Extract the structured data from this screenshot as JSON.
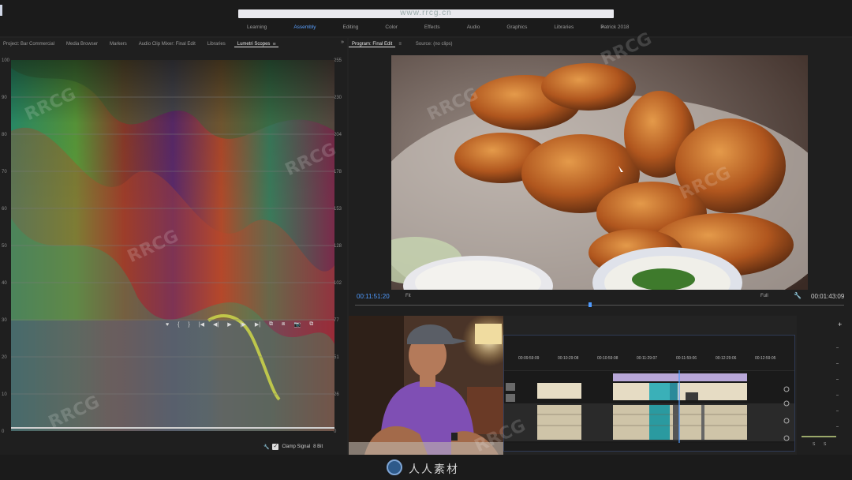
{
  "titlebar": {
    "url_text": "www.rrcg.cn"
  },
  "workspaces": {
    "tabs": [
      {
        "label": "Learning",
        "active": false
      },
      {
        "label": "Assembly",
        "active": true
      },
      {
        "label": "Editing",
        "active": false
      },
      {
        "label": "Color",
        "active": false
      },
      {
        "label": "Effects",
        "active": false
      },
      {
        "label": "Audio",
        "active": false
      },
      {
        "label": "Graphics",
        "active": false
      },
      {
        "label": "Libraries",
        "active": false
      },
      {
        "label": "Patrick 2018",
        "active": false
      }
    ],
    "more": "»"
  },
  "left_panel": {
    "tabs": [
      {
        "label": "Project: Bar Commercial",
        "active": false
      },
      {
        "label": "Media Browser",
        "active": false
      },
      {
        "label": "Markers",
        "active": false
      },
      {
        "label": "Audio Clip Mixer: Final Edit",
        "active": false
      },
      {
        "label": "Libraries",
        "active": false
      },
      {
        "label": "Lumetri Scopes",
        "active": true
      }
    ],
    "menu_glyph": "≡",
    "more": "»",
    "scope": {
      "left_scale": [
        "100",
        "90",
        "80",
        "70",
        "60",
        "50",
        "40",
        "30",
        "20",
        "10",
        "0"
      ],
      "right_scale": [
        "255",
        "230",
        "204",
        "178",
        "153",
        "128",
        "102",
        "77",
        "51",
        "26",
        "0"
      ]
    },
    "footer": {
      "clamp_label": "Clamp Signal",
      "bit_label": "8 Bit",
      "wrench": "🔧"
    }
  },
  "program_monitor": {
    "tabs": [
      {
        "label": "Program: Final Edit",
        "active": true
      },
      {
        "label": "Source: (no clips)",
        "active": false
      }
    ],
    "menu_glyph": "≡",
    "timecode_current": "00:11:51:20",
    "fit_label": "Fit",
    "quality_label": "Full",
    "timecode_duration": "00:01:43:09",
    "transport": [
      "♥",
      "{",
      "}",
      "|◀",
      "◀|",
      "▶",
      "|▶",
      "▶|",
      "⧉",
      "⧈",
      "📷",
      "⧉"
    ]
  },
  "timeline": {
    "ruler_labels": [
      "00:09:59:09",
      "00:10:29:08",
      "00:10:59:08",
      "00:11:29:07",
      "00:11:59:06",
      "00:12:29:06",
      "00:12:59:05"
    ]
  },
  "audio_meters": {
    "labels": [
      "S",
      "S"
    ]
  },
  "bottom": {
    "logo_text": "人人素材"
  },
  "colors": {
    "accent": "#4f9bff",
    "background": "#232323",
    "panel": "#1f1f1f"
  }
}
